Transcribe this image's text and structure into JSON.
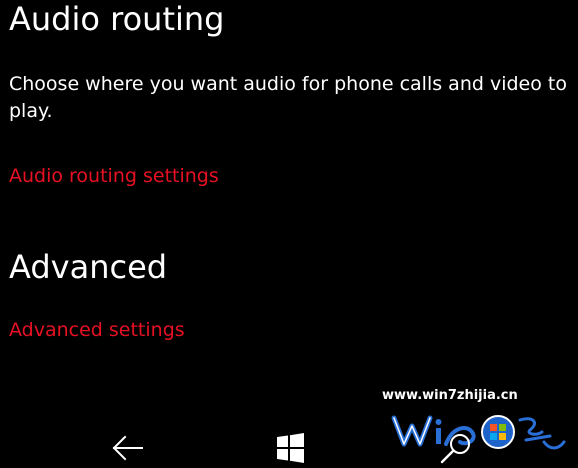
{
  "sections": {
    "audio_routing": {
      "title": "Audio routing",
      "description": "Choose where you want audio for phone calls and video to play.",
      "link": "Audio routing settings"
    },
    "advanced": {
      "title": "Advanced",
      "link": "Advanced settings"
    }
  },
  "watermark": {
    "url": "www.win7zhijia.cn"
  },
  "navbar": {
    "icons": [
      "back-arrow-icon",
      "windows-start-icon",
      "search-icon"
    ]
  },
  "colors": {
    "background": "#000000",
    "text": "#ffffff",
    "accent": "#e81123"
  }
}
